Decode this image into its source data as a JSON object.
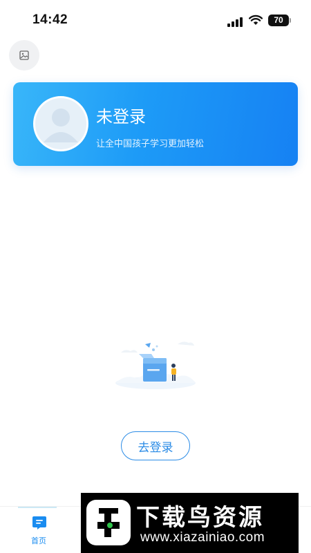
{
  "status_bar": {
    "time": "14:42",
    "battery": "70"
  },
  "header": {
    "image_button_icon": "image-icon"
  },
  "login_card": {
    "title": "未登录",
    "subtitle": "让全中国孩子学习更加轻松",
    "avatar_icon": "default-avatar-icon",
    "gradient_start": "#39b6f9",
    "gradient_end": "#1681f3"
  },
  "empty_state": {
    "illustration_icon": "empty-box-illustration",
    "button_label": "去登录",
    "accent": "#2a8be6"
  },
  "tab_bar": {
    "tabs": [
      {
        "label": "首页",
        "icon": "home-doc-icon",
        "active": true,
        "color": "#1a8cf0"
      }
    ]
  },
  "watermark": {
    "title": "下载鸟资源",
    "url": "www.xiazainiao.com",
    "logo_icon": "bird-logo-icon"
  }
}
